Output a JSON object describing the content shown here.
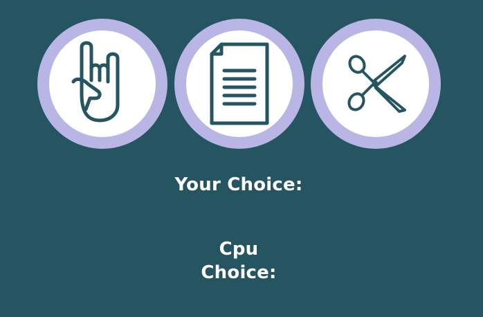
{
  "choices": [
    {
      "label": "Rock",
      "icon": "rock-hand-icon"
    },
    {
      "label": "Paper",
      "icon": "paper-document-icon"
    },
    {
      "label": "Scissors",
      "icon": "scissors-icon"
    }
  ],
  "labels": {
    "your_choice": "Your Choice:",
    "cpu_line1": "Cpu",
    "cpu_line2": "Choice:"
  },
  "colors": {
    "background": "#245561",
    "ring": "#b9b5e4",
    "icon_stroke": "#245561",
    "text": "#ffffff"
  }
}
